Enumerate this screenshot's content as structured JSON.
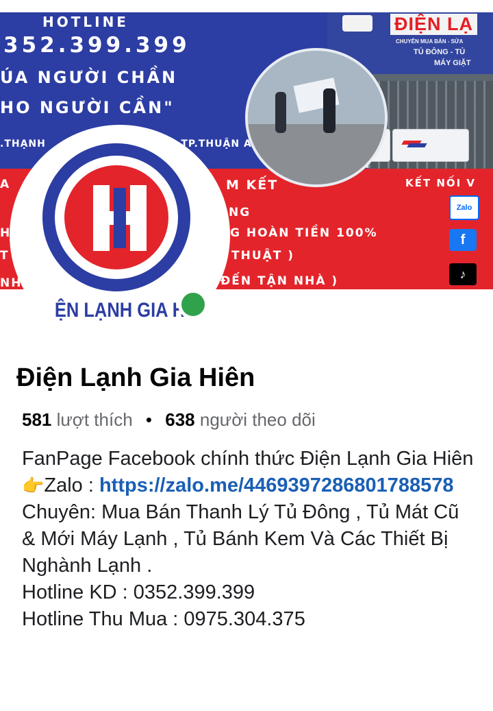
{
  "cover": {
    "hotline_label": "HOTLINE",
    "hotline_number": "352.399.399",
    "slogan_line1": "ÚA NGƯỜI CHẦN",
    "slogan_line2": "HO NGƯỜI CẦN\"",
    "address_left": ".THẠNH",
    "address_right": ",TP.THUẬN AN",
    "shop_sign_title": "ĐIỆN LẠ",
    "shop_sign_line1": "CHUYÊN MUA BÁN - SỬA",
    "shop_sign_line2": "TỦ ĐÔNG - TỦ",
    "shop_sign_line3": "MÁY GIẶT",
    "red_line1": "A",
    "red_line1_right": "M KẾT",
    "red_line2_right": "NG",
    "red_line3": "H",
    "red_line3_right": "G HOÀN TIỀN 100%",
    "red_line4": "T",
    "red_line4_right": "THUẬT )",
    "red_line5": "NH",
    "red_line5_right": "ĐẾN TẬN NHÀ )",
    "connect_label": "KẾT NỐI V",
    "social": [
      {
        "name": "zalo",
        "label": "Zalo"
      },
      {
        "name": "facebook",
        "label": "f"
      },
      {
        "name": "tiktok",
        "label": "♪"
      }
    ]
  },
  "avatar": {
    "caption": "ỆN LẠNH GIA H"
  },
  "page": {
    "name": "Điện Lạnh Gia Hiên",
    "likes_count": "581",
    "likes_label": "lượt thích",
    "followers_count": "638",
    "followers_label": "người theo dõi",
    "bio_line1": "FanPage Facebook chính thức Điện Lạnh Gia Hiên",
    "zalo_prefix": "Zalo : ",
    "zalo_link": "https://zalo.me/4469397286801788578",
    "specialty": "Chuyên: Mua Bán Thanh Lý Tủ Đông , Tủ Mát Cũ & Mới Máy Lạnh , Tủ Bánh Kem Và Các Thiết Bị Nghành Lạnh .",
    "hotline_kd": "Hotline KD : 0352.399.399",
    "hotline_thumua": "Hotline Thu Mua : 0975.304.375"
  },
  "colors": {
    "brand_blue": "#2c3da3",
    "brand_red": "#e3242b",
    "link": "#1a5fb4",
    "online": "#31a24c"
  }
}
